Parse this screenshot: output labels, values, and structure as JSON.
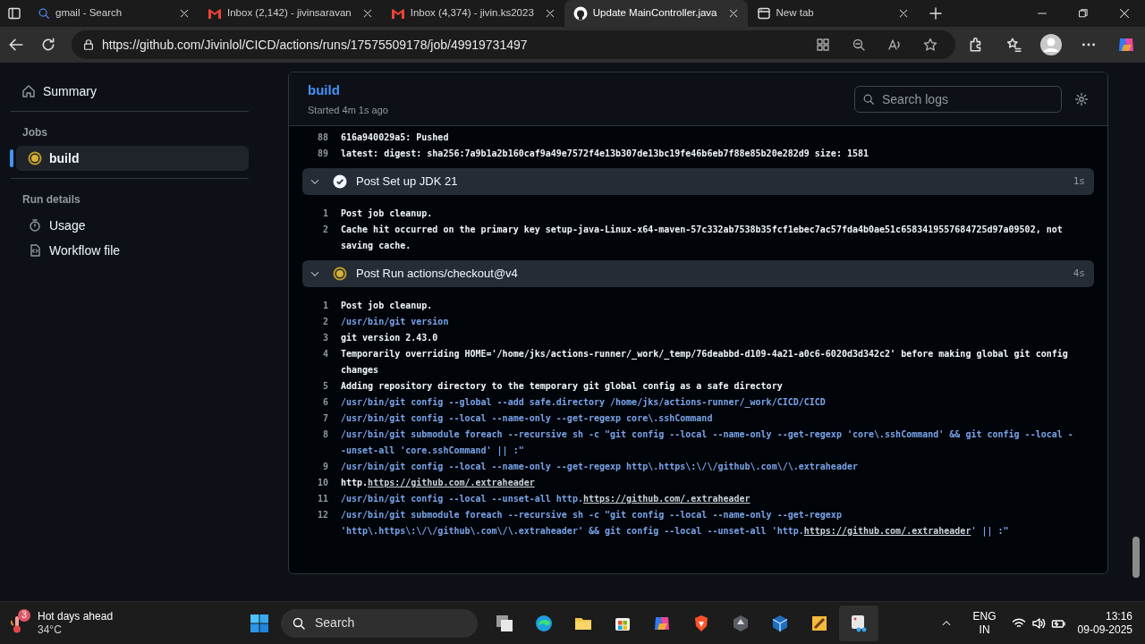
{
  "browser": {
    "tabs": [
      {
        "title": "gmail - Search",
        "kind": "search",
        "selected": false
      },
      {
        "title": "Inbox (2,142) - jivinsaravan",
        "kind": "mail",
        "selected": false
      },
      {
        "title": "Inbox (4,374) - jivin.ks2023",
        "kind": "mail",
        "selected": false
      },
      {
        "title": "Update MainController.java",
        "kind": "repo",
        "selected": true
      },
      {
        "title": "New tab",
        "kind": "newtab",
        "selected": false
      }
    ],
    "url": "https://github.com/Jivinlol/CICD/actions/runs/17575509178/job/49919731497"
  },
  "sidebar": {
    "summary": "Summary",
    "sections": [
      {
        "heading": "Jobs",
        "items": [
          {
            "label": "build",
            "kind": "job",
            "selected": true
          }
        ]
      },
      {
        "heading": "Run details",
        "items": [
          {
            "label": "Usage",
            "kind": "usage",
            "selected": false
          },
          {
            "label": "Workflow file",
            "kind": "file",
            "selected": false
          }
        ]
      }
    ]
  },
  "job": {
    "title": "build",
    "subtitle": "Started 4m 1s ago",
    "search": {
      "placeholder": "Search logs"
    }
  },
  "log": {
    "lines": [
      {
        "number": "88",
        "kind": "output",
        "text": "616a940029a5: Pushed"
      },
      {
        "number": "89",
        "kind": "output",
        "text": "latest: digest: sha256:7a9b1a2b160caf9a49e7572f4e13b307de13bc19fe46b6eb7f88e85b20e282d9 size: 1581"
      }
    ],
    "steps": [
      {
        "title": "Post Set up JDK 21",
        "kind": "success",
        "duration": "1s",
        "expanded": true,
        "lines": [
          {
            "number": "1",
            "kind": "output",
            "text": "Post job cleanup."
          },
          {
            "number": "2",
            "kind": "output",
            "text": "Cache hit occurred on the primary key setup-java-Linux-x64-maven-57c332ab7538b35fcf1ebec7ac57fda4b0ae51c6583419557684725d97a09502, not saving cache."
          }
        ]
      },
      {
        "title": "Post Run actions/checkout@v4",
        "kind": "running",
        "duration": "4s",
        "expanded": true,
        "lines": [
          {
            "number": "1",
            "kind": "output",
            "text": "Post job cleanup."
          },
          {
            "number": "2",
            "kind": "command",
            "text": "/usr/bin/git version"
          },
          {
            "number": "3",
            "kind": "output",
            "text": "git version 2.43.0"
          },
          {
            "number": "4",
            "kind": "output",
            "text": "Temporarily overriding HOME='/home/jks/actions-runner/_work/_temp/76deabbd-d109-4a21-a0c6-6020d3d342c2' before making global git config changes"
          },
          {
            "number": "5",
            "kind": "output",
            "text": "Adding repository directory to the temporary git global config as a safe directory"
          },
          {
            "number": "6",
            "kind": "command",
            "text": "/usr/bin/git config --global --add safe.directory /home/jks/actions-runner/_work/CICD/CICD"
          },
          {
            "number": "7",
            "kind": "command",
            "text": "/usr/bin/git config --local --name-only --get-regexp core\\.sshCommand"
          },
          {
            "number": "8",
            "kind": "command",
            "text": "/usr/bin/git submodule foreach --recursive sh -c \"git config --local --name-only --get-regexp 'core\\.sshCommand' && git config --local --unset-all 'core.sshCommand' || :\""
          },
          {
            "number": "9",
            "kind": "command",
            "text": "/usr/bin/git config --local --name-only --get-regexp http\\.https\\:\\/\\/github\\.com\\/\\.extraheader"
          },
          {
            "number": "10",
            "kind": "output",
            "parts": [
              {
                "kind": "text",
                "text": "http."
              },
              {
                "kind": "link",
                "text": "https://github.com/.extraheader"
              }
            ]
          },
          {
            "number": "11",
            "kind": "command",
            "parts": [
              {
                "kind": "text",
                "text": "/usr/bin/git config --local --unset-all http."
              },
              {
                "kind": "link",
                "text": "https://github.com/.extraheader"
              }
            ]
          },
          {
            "number": "12",
            "kind": "command",
            "parts": [
              {
                "kind": "text",
                "text": "/usr/bin/git submodule foreach --recursive sh -c \"git config --local --name-only --get-regexp 'http\\.https\\:\\/\\/github\\.com\\/\\.extraheader' && git config --local --unset-all 'http."
              },
              {
                "kind": "link",
                "text": "https://github.com/.extraheader"
              },
              {
                "kind": "text",
                "text": "' || :\""
              }
            ]
          }
        ]
      }
    ]
  },
  "taskbar": {
    "weather": {
      "badge": "3",
      "title": "Hot days ahead",
      "temperature": "34°C"
    },
    "search": {
      "placeholder": "Search"
    },
    "language": "ENG",
    "region": "IN",
    "time": "13:16",
    "date": "09-09-2025"
  }
}
